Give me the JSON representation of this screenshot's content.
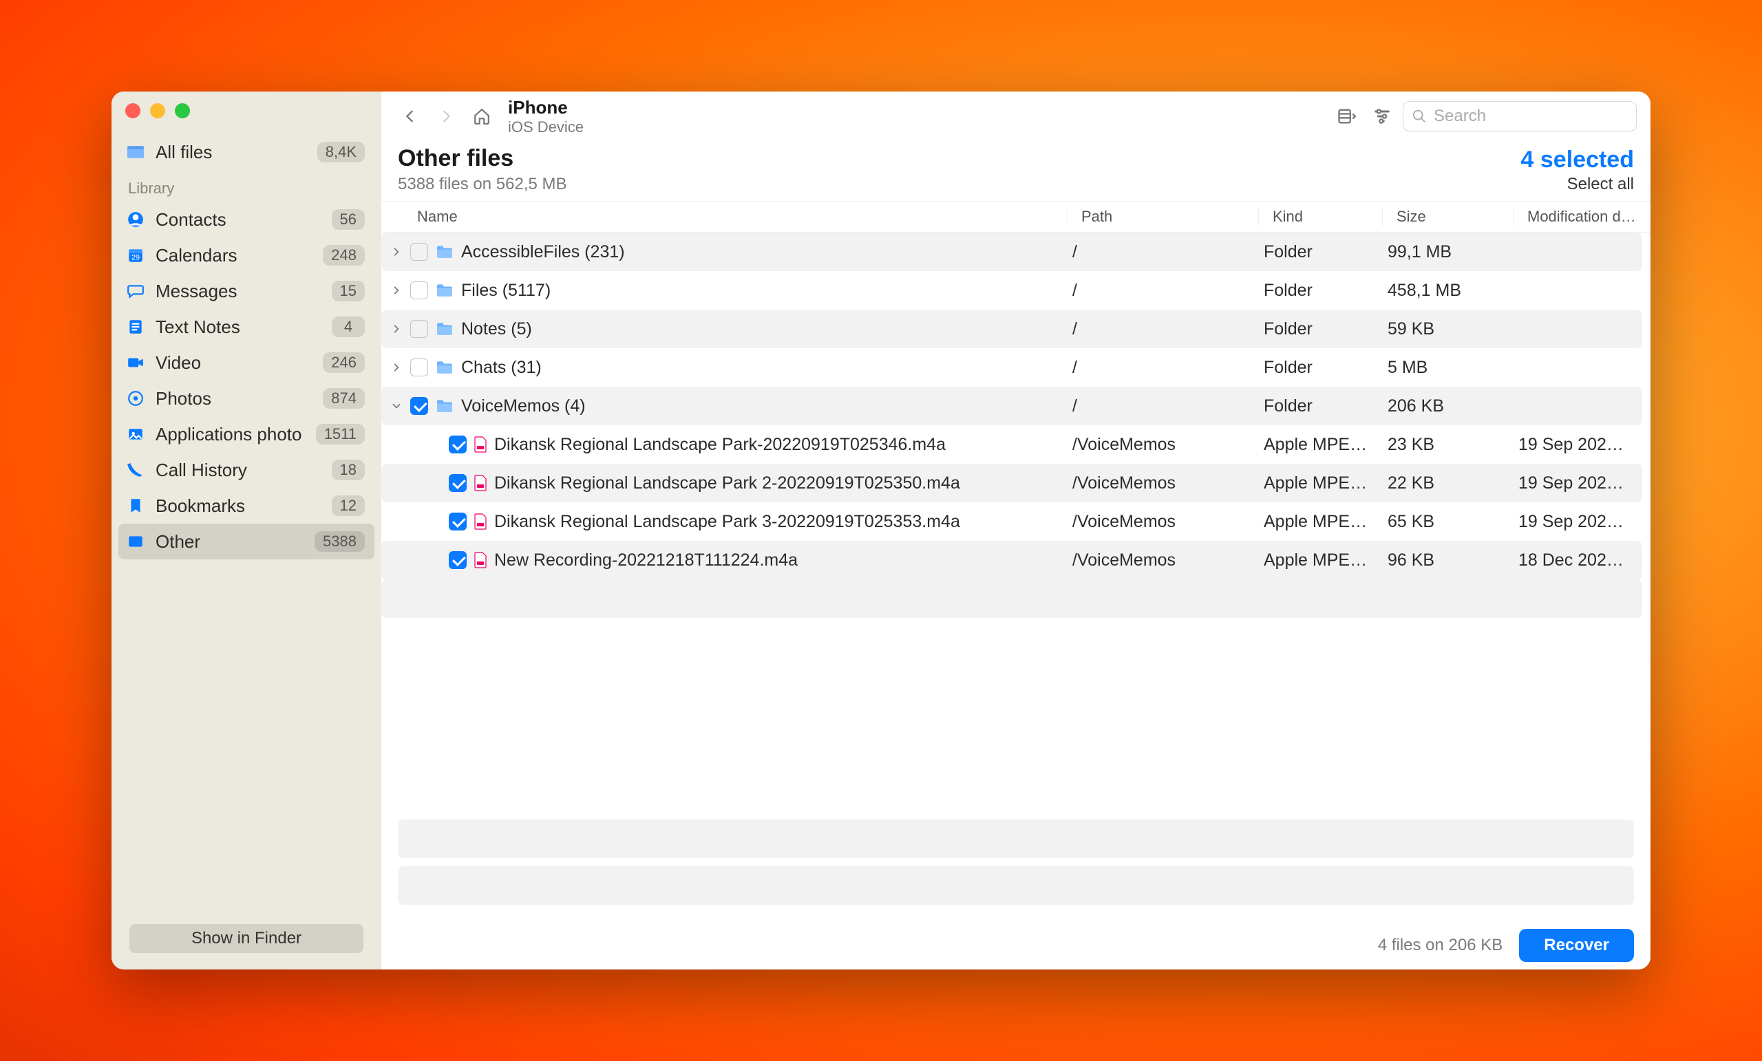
{
  "sidebar": {
    "allfiles": {
      "label": "All files",
      "count": "8,4K"
    },
    "library_label": "Library",
    "items": [
      {
        "label": "Contacts",
        "count": "56",
        "color": "#0a7aff"
      },
      {
        "label": "Calendars",
        "count": "248",
        "color": "#0a7aff"
      },
      {
        "label": "Messages",
        "count": "15",
        "color": "#0a7aff"
      },
      {
        "label": "Text Notes",
        "count": "4",
        "color": "#0a7aff"
      },
      {
        "label": "Video",
        "count": "246",
        "color": "#0a7aff"
      },
      {
        "label": "Photos",
        "count": "874",
        "color": "#0a7aff"
      },
      {
        "label": "Applications photo",
        "count": "1511",
        "color": "#0a7aff"
      },
      {
        "label": "Call History",
        "count": "18",
        "color": "#0a7aff"
      },
      {
        "label": "Bookmarks",
        "count": "12",
        "color": "#0a7aff"
      },
      {
        "label": "Other",
        "count": "5388",
        "color": "#0a7aff"
      }
    ],
    "finder_button": "Show in Finder"
  },
  "toolbar": {
    "title": "iPhone",
    "subtitle": "iOS Device",
    "search_placeholder": "Search"
  },
  "page": {
    "title": "Other files",
    "subtitle": "5388 files on 562,5 MB",
    "selected_label": "4 selected",
    "select_all": "Select all"
  },
  "columns": {
    "name": "Name",
    "path": "Path",
    "kind": "Kind",
    "size": "Size",
    "mod": "Modification d…"
  },
  "rows": [
    {
      "type": "folder",
      "expanded": false,
      "checked": false,
      "name": "AccessibleFiles (231)",
      "path": "/",
      "kind": "Folder",
      "size": "99,1 MB",
      "mod": ""
    },
    {
      "type": "folder",
      "expanded": false,
      "checked": false,
      "name": "Files (5117)",
      "path": "/",
      "kind": "Folder",
      "size": "458,1 MB",
      "mod": ""
    },
    {
      "type": "folder",
      "expanded": false,
      "checked": false,
      "name": "Notes (5)",
      "path": "/",
      "kind": "Folder",
      "size": "59 KB",
      "mod": ""
    },
    {
      "type": "folder",
      "expanded": false,
      "checked": false,
      "name": "Chats (31)",
      "path": "/",
      "kind": "Folder",
      "size": "5 MB",
      "mod": ""
    },
    {
      "type": "folder",
      "expanded": true,
      "checked": true,
      "name": "VoiceMemos (4)",
      "path": "/",
      "kind": "Folder",
      "size": "206 KB",
      "mod": ""
    },
    {
      "type": "file",
      "checked": true,
      "name": "Dikansk Regional Landscape Park-20220919T025346.m4a",
      "path": "/VoiceMemos",
      "kind": "Apple MPEG…",
      "size": "23 KB",
      "mod": "19 Sep 202…"
    },
    {
      "type": "file",
      "checked": true,
      "name": "Dikansk Regional Landscape Park 2-20220919T025350.m4a",
      "path": "/VoiceMemos",
      "kind": "Apple MPEG…",
      "size": "22 KB",
      "mod": "19 Sep 202…"
    },
    {
      "type": "file",
      "checked": true,
      "name": "Dikansk Regional Landscape Park 3-20220919T025353.m4a",
      "path": "/VoiceMemos",
      "kind": "Apple MPEG…",
      "size": "65 KB",
      "mod": "19 Sep 202…"
    },
    {
      "type": "file",
      "checked": true,
      "name": "New Recording-20221218T111224.m4a",
      "path": "/VoiceMemos",
      "kind": "Apple MPEG…",
      "size": "96 KB",
      "mod": "18 Dec 202…"
    }
  ],
  "bottom": {
    "summary": "4 files on 206 KB",
    "recover": "Recover"
  }
}
